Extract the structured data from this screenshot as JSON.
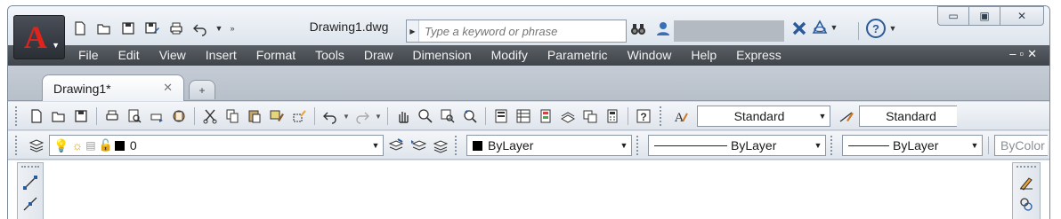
{
  "titlebar": {
    "document_title": "Drawing1.dwg",
    "search_placeholder": "Type a keyword or phrase",
    "app_logo": "A",
    "help_label": "?",
    "window_controls": {
      "minimize": "▭",
      "restore": "▣",
      "close": "✕"
    }
  },
  "quick_access": {
    "icons": [
      "new-icon",
      "open-icon",
      "save-icon",
      "save-as-icon",
      "plot-icon",
      "undo-icon",
      "more-icon"
    ]
  },
  "menubar": {
    "items": [
      "File",
      "Edit",
      "View",
      "Insert",
      "Format",
      "Tools",
      "Draw",
      "Dimension",
      "Modify",
      "Parametric",
      "Window",
      "Help",
      "Express"
    ],
    "doc_controls": "–▫✕"
  },
  "file_tabs": {
    "active": {
      "label": "Drawing1*",
      "close": "✕"
    },
    "new_tab": "+"
  },
  "standard_toolbar": {
    "text_style": "Standard",
    "dim_style": "Standard"
  },
  "layers_toolbar": {
    "current_layer": "0",
    "color": "ByLayer",
    "linetype": "ByLayer",
    "lineweight": "ByLayer",
    "plot_style": "ByColor"
  },
  "colors": {
    "menubar_bg": "#4a4f56",
    "logo_red": "#e2231a",
    "accent_blue": "#2b5a9a"
  }
}
